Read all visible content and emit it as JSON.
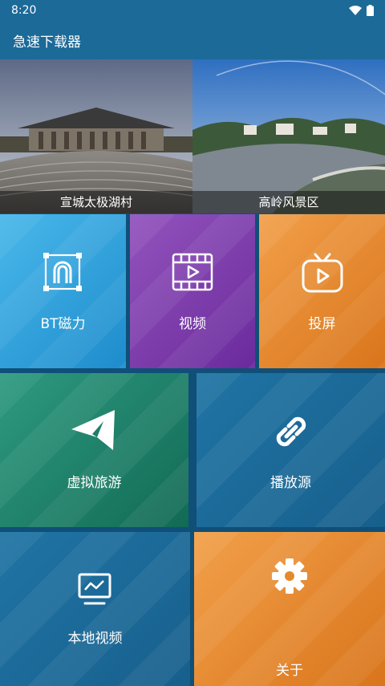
{
  "status_bar": {
    "time": "8:20"
  },
  "app": {
    "title": "急速下载器"
  },
  "banners": [
    {
      "caption": "宣城太极湖村"
    },
    {
      "caption": "高岭风景区"
    }
  ],
  "tiles": {
    "bt": {
      "label": "BT磁力",
      "icon": "magnet-icon"
    },
    "video": {
      "label": "视频",
      "icon": "film-icon"
    },
    "cast": {
      "label": "投屏",
      "icon": "tv-icon"
    },
    "vr_tour": {
      "label": "虚拟旅游",
      "icon": "paper-plane-icon"
    },
    "source": {
      "label": "播放源",
      "icon": "link-icon"
    },
    "local_video": {
      "label": "本地视频",
      "icon": "monitor-icon"
    },
    "about": {
      "label": "关于",
      "icon": "gear-icon"
    }
  },
  "colors": {
    "status_bar": "#1b6a98",
    "background": "#0f4f78",
    "bt_tile": "#2a9fd6",
    "video_tile": "#7e3fae",
    "cast_tile": "#ea8a2e",
    "vr_tile": "#1e8a72",
    "source_tile": "#1b6a98",
    "local_tile": "#1b6a98",
    "about_tile": "#ea8a2e"
  }
}
